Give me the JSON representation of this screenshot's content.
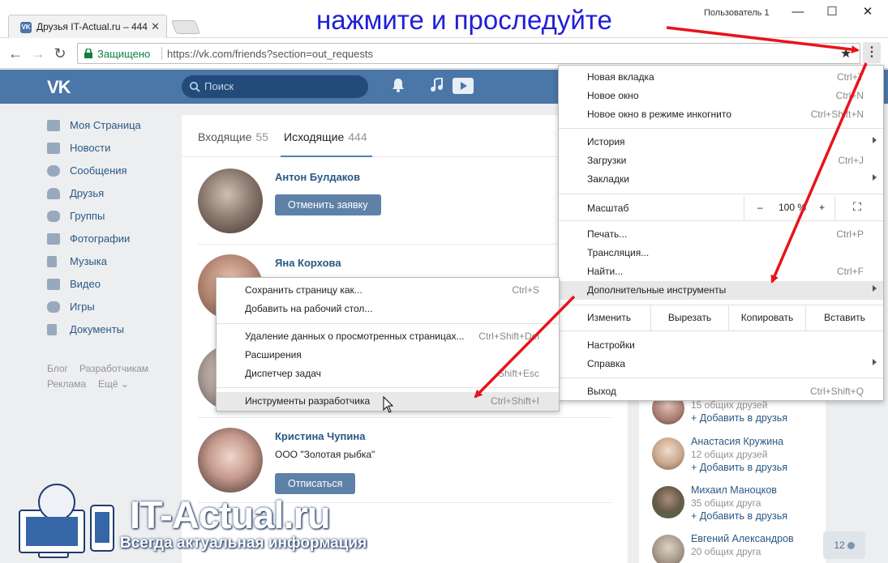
{
  "browser": {
    "tab_title": "Друзья IT-Actual.ru – 444",
    "profile": "Пользователь 1",
    "window_min": "—",
    "window_max": "☐",
    "window_close": "✕",
    "secure_label": "Защищено",
    "url": "https://vk.com/friends?section=out_requests",
    "back": "←",
    "forward": "→",
    "reload": "↻",
    "star": "★",
    "menu_dots": "⋮"
  },
  "instruction": "нажмите и проследуйте",
  "vk": {
    "logo": "VK",
    "search_placeholder": "Поиск",
    "sidebar": [
      {
        "label": "Моя Страница",
        "icon": "home-icon"
      },
      {
        "label": "Новости",
        "icon": "news-icon"
      },
      {
        "label": "Сообщения",
        "icon": "messages-icon"
      },
      {
        "label": "Друзья",
        "icon": "friends-icon"
      },
      {
        "label": "Группы",
        "icon": "groups-icon"
      },
      {
        "label": "Фотографии",
        "icon": "photos-icon"
      },
      {
        "label": "Музыка",
        "icon": "music-icon"
      },
      {
        "label": "Видео",
        "icon": "video-icon"
      },
      {
        "label": "Игры",
        "icon": "games-icon"
      },
      {
        "label": "Документы",
        "icon": "documents-icon"
      }
    ],
    "footer": {
      "blog": "Блог",
      "dev": "Разработчикам",
      "ads": "Реклама",
      "more": "Ещё ⌄"
    },
    "tabs": {
      "incoming_label": "Входящие",
      "incoming_count": "55",
      "outgoing_label": "Исходящие",
      "outgoing_count": "444"
    },
    "people": [
      {
        "name": "Антон Булдаков",
        "info": "",
        "button": "Отменить заявку"
      },
      {
        "name": "Яна Корхова",
        "info": "",
        "button": ""
      },
      {
        "name": "",
        "info": "",
        "button": ""
      },
      {
        "name": "Кристина Чупина",
        "info": "ООО \"Золотая рыбка\"",
        "button": "Отписаться"
      }
    ],
    "suggestions": [
      {
        "name": "",
        "common": "15 общих друзей",
        "add": "+ Добавить в друзья"
      },
      {
        "name": "Анастасия Кружина",
        "common": "12 общих друзей",
        "add": "+ Добавить в друзья"
      },
      {
        "name": "Михаил Маноцков",
        "common": "35 общих друга",
        "add": "+ Добавить в друзья"
      },
      {
        "name": "Евгений Александров",
        "common": "20 общих друга",
        "add": "+ Добавить в друзья"
      }
    ],
    "badge_count": "12"
  },
  "chrome_menu": {
    "new_tab": {
      "label": "Новая вкладка",
      "shortcut": "Ctrl+T"
    },
    "new_window": {
      "label": "Новое окно",
      "shortcut": "Ctrl+N"
    },
    "incognito": {
      "label": "Новое окно в режиме инкогнито",
      "shortcut": "Ctrl+Shift+N"
    },
    "history": {
      "label": "История"
    },
    "downloads": {
      "label": "Загрузки",
      "shortcut": "Ctrl+J"
    },
    "bookmarks": {
      "label": "Закладки"
    },
    "zoom": {
      "label": "Масштаб",
      "minus": "–",
      "value": "100 %",
      "plus": "+",
      "fullscreen": "⛶"
    },
    "print": {
      "label": "Печать...",
      "shortcut": "Ctrl+P"
    },
    "cast": {
      "label": "Трансляция..."
    },
    "find": {
      "label": "Найти...",
      "shortcut": "Ctrl+F"
    },
    "more_tools": {
      "label": "Дополнительные инструменты"
    },
    "edit": {
      "label": "Изменить",
      "cut": "Вырезать",
      "copy": "Копировать",
      "paste": "Вставить"
    },
    "settings": {
      "label": "Настройки"
    },
    "help": {
      "label": "Справка"
    },
    "exit": {
      "label": "Выход",
      "shortcut": "Ctrl+Shift+Q"
    }
  },
  "submenu": {
    "save_page": {
      "label": "Сохранить страницу как...",
      "shortcut": "Ctrl+S"
    },
    "add_desktop": {
      "label": "Добавить на рабочий стол..."
    },
    "clear_data": {
      "label": "Удаление данных о просмотренных страницах...",
      "shortcut": "Ctrl+Shift+Del"
    },
    "extensions": {
      "label": "Расширения"
    },
    "task_manager": {
      "label": "Диспетчер задач",
      "shortcut": "Shift+Esc"
    },
    "devtools": {
      "label": "Инструменты разработчика",
      "shortcut": "Ctrl+Shift+I"
    }
  },
  "watermark": {
    "brand": "IT-Actual.ru",
    "slogan": "Всегда актуальная информация"
  },
  "colors": {
    "vk_blue": "#4a76a8",
    "link": "#2a5885",
    "arrow_red": "#e8141b",
    "instruction_blue": "#1f1fd6"
  }
}
